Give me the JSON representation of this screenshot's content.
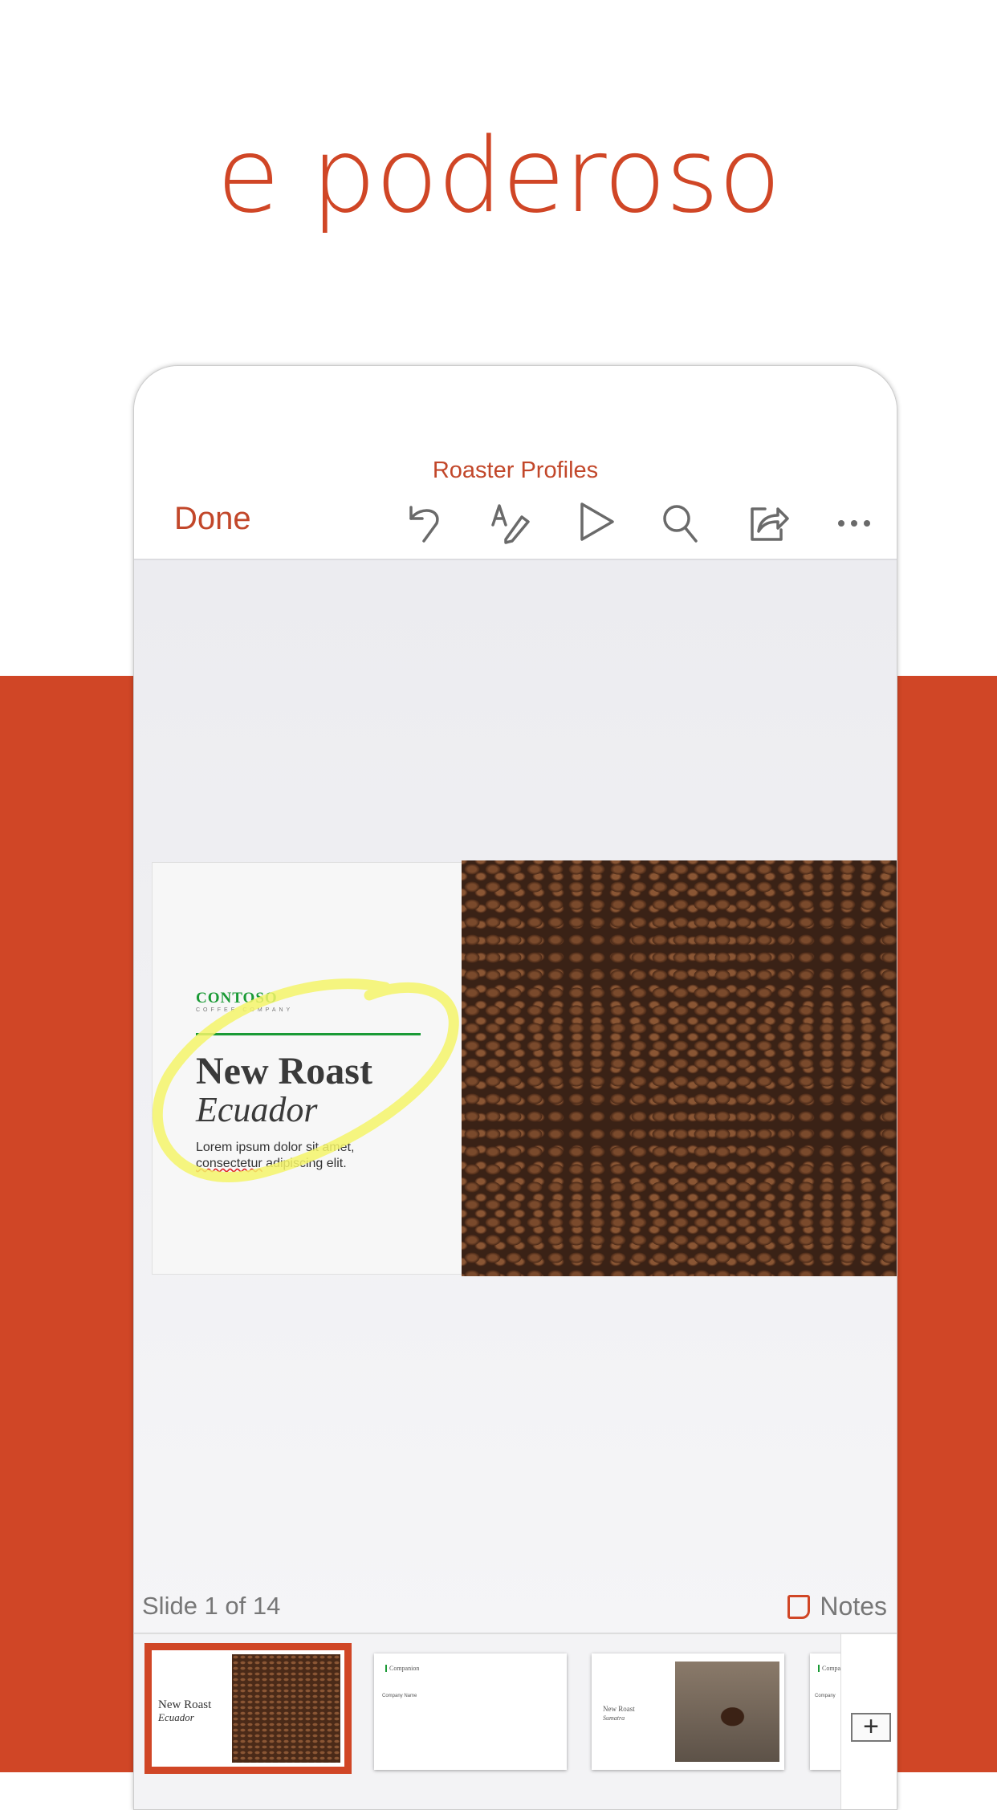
{
  "headline": "e poderoso",
  "app": {
    "doc_title": "Roaster Profiles",
    "done_label": "Done",
    "toolbar_icons": [
      "undo-icon",
      "draw-icon",
      "play-icon",
      "search-icon",
      "share-icon",
      "more-icon"
    ],
    "slide": {
      "brand": "CONTOSO",
      "brand_sub": "COFFEE COMPANY",
      "title": "New Roast",
      "subtitle": "Ecuador",
      "body_line1": "Lorem ipsum dolor sit amet,",
      "body_word_err": "consectetur",
      "body_rest": " adipiscing elit."
    },
    "status": {
      "slide_count": "Slide 1 of 14",
      "notes_label": "Notes"
    },
    "thumbnails": [
      {
        "title": "New Roast",
        "subtitle": "Ecuador"
      },
      {
        "title": "Companion",
        "subtitle": "Company Name"
      },
      {
        "title": "New Roast",
        "subtitle": "Sumatra"
      },
      {
        "title": "Compa",
        "subtitle": "Company"
      }
    ],
    "add_label": "+",
    "colors": {
      "accent": "#D04626",
      "brand_green": "#1A9A35"
    }
  }
}
